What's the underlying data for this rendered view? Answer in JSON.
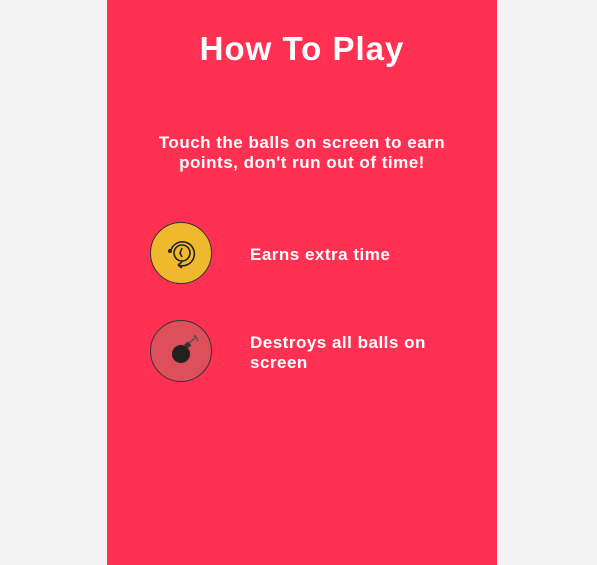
{
  "title": "How To Play",
  "description": "Touch the balls on screen to earn points, don't run out of time!",
  "items": [
    {
      "icon": "time-restore-icon",
      "label": "Earns extra time",
      "color": "#f0b82d"
    },
    {
      "icon": "bomb-icon",
      "label": "Destroys all balls on screen",
      "color": "#dc4f5b"
    }
  ]
}
